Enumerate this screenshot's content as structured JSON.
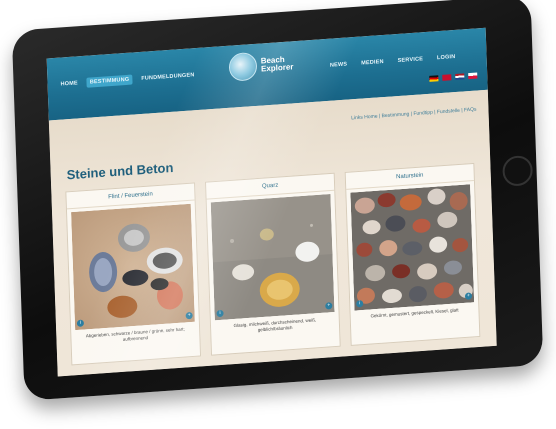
{
  "nav": {
    "left": [
      "HOME",
      "BESTIMMUNG",
      "FUNDMELDUNGEN"
    ],
    "right": [
      "NEWS",
      "MEDIEN",
      "SERVICE",
      "LOGIN"
    ]
  },
  "logo": {
    "line1": "Beach",
    "line2": "Explorer"
  },
  "breadcrumb": "Links Home | Bestimmung | Fundtipp | Fundstelle | FAQs",
  "page_title": "Steine und Beton",
  "cards": [
    {
      "title": "Flint / Feuerstein",
      "caption": "Abgerieben, schwarze / braune / grüne, sehr hart; aufbrennend"
    },
    {
      "title": "Quarz",
      "caption": "Glasig, milchweiß, durchscheinend, weiß, gelblich/bräunlich"
    },
    {
      "title": "Naturstein",
      "caption": "Gekörnt, gemustert, gespeckelt, Kiesel, glatt"
    }
  ],
  "colors": {
    "header": "#1d6f91",
    "accent": "#2d6f8c",
    "background": "#f2ebe0"
  }
}
